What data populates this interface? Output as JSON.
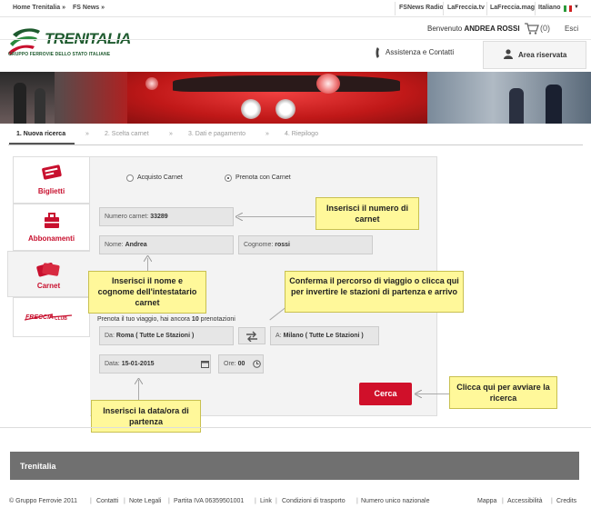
{
  "topbar": {
    "left_links": [
      "Home Trenitalia »",
      "FS News »"
    ],
    "right_links": [
      "FSNews Radio",
      "LaFreccia.tv",
      "LaFreccia.mag"
    ],
    "language": "Italiano"
  },
  "header": {
    "brand": "TRENITALIA",
    "brand_sub": "GRUPPO FERROVIE DELLO STATO ITALIANE",
    "welcome_prefix": "Benvenuto",
    "welcome_user": "ANDREA ROSSI",
    "cart_count": "(0)",
    "logout": "Esci",
    "assist": "Assistenza e Contatti",
    "area": "Area riservata"
  },
  "steps": [
    "1. Nuova ricerca",
    "»",
    "2. Scelta carnet",
    "»",
    "3. Dati e pagamento",
    "»",
    "4. Riepilogo"
  ],
  "tabs": [
    "Biglietti",
    "Abbonamenti",
    "Carnet",
    "CartaFRECCIA"
  ],
  "form": {
    "radio1": "Acquisto Carnet",
    "radio2": "Prenota con Carnet",
    "carnet_label": "Numero carnet:",
    "carnet_value": "33289",
    "name_label": "Nome:",
    "name_value": "Andrea",
    "surname_label": "Cognome:",
    "surname_value": "rossi",
    "hint_prefix": "Prenota il tuo viaggio, hai ancora",
    "hint_count": "10",
    "hint_suffix": "prenotazioni",
    "from_label": "Da:",
    "from_value": "Roma ( Tutte Le Stazioni )",
    "to_label": "A:",
    "to_value": "Milano ( Tutte Le Stazioni )",
    "date_label": "Data:",
    "date_value": "15-01-2015",
    "time_label": "Ore:",
    "time_value": "00",
    "search": "Cerca"
  },
  "callouts": {
    "carnet": "Inserisci il numero di carnet",
    "name": "Inserisci il nome e cognome dell'intestatario carnet",
    "route": "Conferma il percorso di viaggio o clicca qui per invertire le stazioni di partenza e arrivo",
    "date": "Inserisci la data/ora di partenza",
    "search": "Clicca qui per avviare la ricerca"
  },
  "footer": {
    "title": "Trenitalia",
    "links": [
      "© Gruppo Ferrovie 2011",
      "Contatti",
      "Note Legali",
      "Partita IVA 06359501001",
      "Link",
      "Condizioni di trasporto",
      "Numero unico nazionale"
    ],
    "right_links": [
      "Mappa",
      "Accessibilità",
      "Credits"
    ]
  },
  "colors": {
    "accent": "#d0102a",
    "brand_green": "#1e5a2e",
    "callout": "#fff89a"
  }
}
